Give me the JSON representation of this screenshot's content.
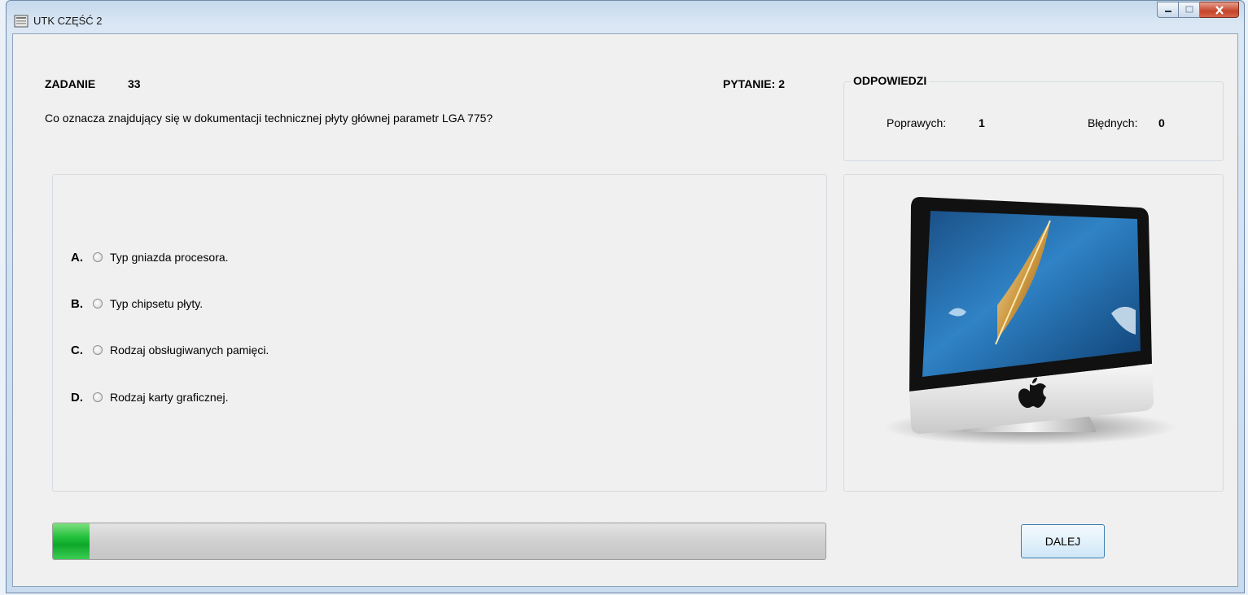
{
  "window": {
    "title": "UTK CZĘŚĆ 2"
  },
  "task": {
    "label": "ZADANIE",
    "number": "33",
    "question_counter": "PYTANIE: 2",
    "question": "Co oznacza znajdujący się w dokumentacji technicznej płyty głównej parametr LGA 775?"
  },
  "answers": [
    {
      "letter": "A.",
      "text": "Typ gniazda procesora."
    },
    {
      "letter": "B.",
      "text": "Typ chipsetu płyty."
    },
    {
      "letter": "C.",
      "text": "Rodzaj obsługiwanych pamięci."
    },
    {
      "letter": "D.",
      "text": "Rodzaj karty graficznej."
    }
  ],
  "score": {
    "title": "ODPOWIEDZI",
    "correct_label": "Poprawych:",
    "correct_value": "1",
    "wrong_label": "Błędnych:",
    "wrong_value": "0"
  },
  "progress": {
    "fraction": 0.047
  },
  "next_button": {
    "label": "DALEJ"
  },
  "colors": {
    "progress_fill": "#1fbf3a",
    "button_border": "#3c7fb1"
  }
}
